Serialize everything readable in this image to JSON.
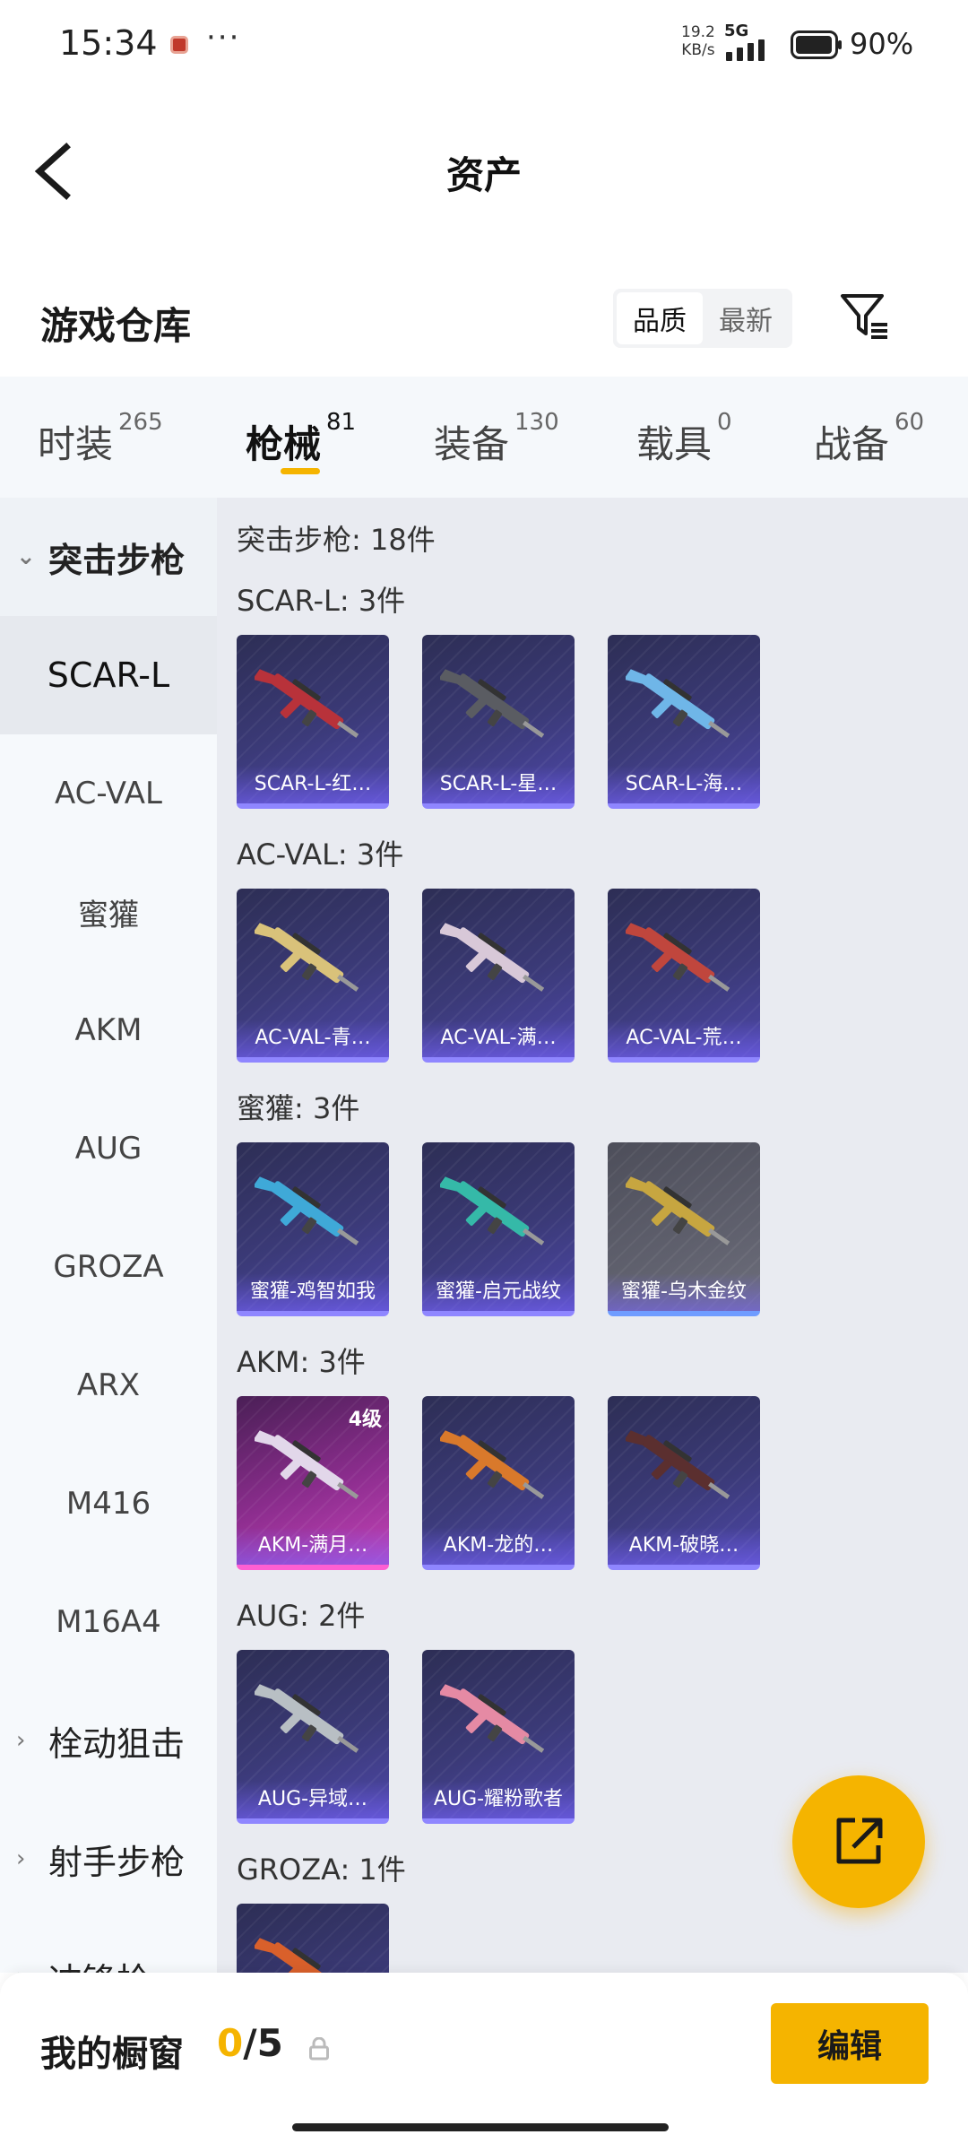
{
  "status": {
    "time": "15:34",
    "speed_value": "19.2",
    "speed_unit": "KB/s",
    "network": "5G",
    "battery": "90%"
  },
  "header": {
    "title": "资产"
  },
  "warehouse": {
    "title": "游戏仓库",
    "sort_options": [
      "品质",
      "最新"
    ],
    "sort_selected": "品质"
  },
  "tabs": [
    {
      "label": "时装",
      "count": "265"
    },
    {
      "label": "枪械",
      "count": "81"
    },
    {
      "label": "装备",
      "count": "130"
    },
    {
      "label": "载具",
      "count": "0"
    },
    {
      "label": "战备",
      "count": "60"
    }
  ],
  "active_tab": "枪械",
  "sidebar": {
    "open_category": "突击步枪",
    "items": [
      "SCAR-L",
      "AC-VAL",
      "蜜獾",
      "AKM",
      "AUG",
      "GROZA",
      "ARX",
      "M416",
      "M16A4"
    ],
    "selected_item": "SCAR-L",
    "collapsed_categories": [
      "栓动狙击",
      "射手步枪",
      "冲锋枪"
    ]
  },
  "main": {
    "category_summary": "突击步枪: 18件",
    "groups": [
      {
        "title": "SCAR-L: 3件",
        "items": [
          {
            "label": "SCAR-L-红…",
            "color": "#b8323a"
          },
          {
            "label": "SCAR-L-星…",
            "color": "#5a5c62"
          },
          {
            "label": "SCAR-L-海…",
            "color": "#6fb6e8"
          }
        ]
      },
      {
        "title": "AC-VAL: 3件",
        "items": [
          {
            "label": "AC-VAL-青…",
            "color": "#d9c27a"
          },
          {
            "label": "AC-VAL-满…",
            "color": "#d8c8d8"
          },
          {
            "label": "AC-VAL-荒…",
            "color": "#c0463d"
          }
        ]
      },
      {
        "title": "蜜獾: 3件",
        "items": [
          {
            "label": "蜜獾-鸡智如我",
            "color": "#3fa9d8"
          },
          {
            "label": "蜜獾-启元战纹",
            "color": "#35b9a8"
          },
          {
            "label": "蜜獾-乌木金纹",
            "color": "#c7a640"
          }
        ]
      },
      {
        "title": "AKM: 3件",
        "items": [
          {
            "label": "AKM-满月…",
            "color": "#e2d7ea",
            "level": "4级"
          },
          {
            "label": "AKM-龙的…",
            "color": "#d9792b"
          },
          {
            "label": "AKM-破晓…",
            "color": "#5b2f2f"
          }
        ]
      },
      {
        "title": "AUG: 2件",
        "items": [
          {
            "label": "AUG-异域…",
            "color": "#b8bfc4"
          },
          {
            "label": "AUG-耀粉歌者",
            "color": "#e58aa4"
          }
        ]
      },
      {
        "title": "GROZA: 1件",
        "items": [
          {
            "label": "",
            "color": "#d9602b"
          }
        ]
      }
    ]
  },
  "bottom": {
    "label": "我的橱窗",
    "count_current": "0",
    "count_total": "/5",
    "edit_label": "编辑"
  }
}
